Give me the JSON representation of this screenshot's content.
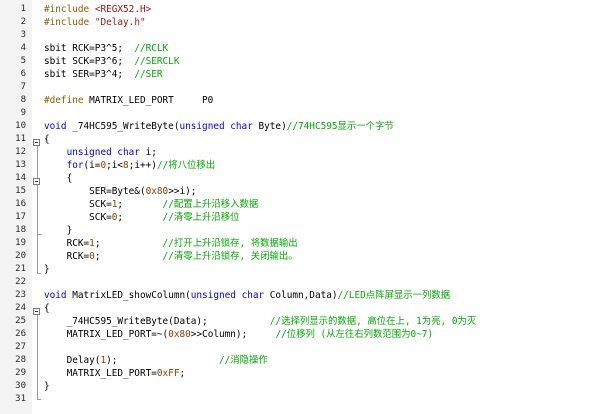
{
  "editor": {
    "lines": [
      {
        "n": "1",
        "tokens": [
          {
            "c": "pp",
            "t": "#include "
          },
          {
            "c": "str",
            "t": "<REGX52.H>"
          }
        ]
      },
      {
        "n": "2",
        "tokens": [
          {
            "c": "pp",
            "t": "#include "
          },
          {
            "c": "str",
            "t": "\"Delay.h\""
          }
        ]
      },
      {
        "n": "3",
        "tokens": []
      },
      {
        "n": "4",
        "tokens": [
          {
            "c": "pl",
            "t": "sbit RCK=P3^5;  "
          },
          {
            "c": "cm",
            "t": "//RCLK"
          }
        ]
      },
      {
        "n": "5",
        "tokens": [
          {
            "c": "pl",
            "t": "sbit SCK=P3^6;  "
          },
          {
            "c": "cm",
            "t": "//SERCLK"
          }
        ]
      },
      {
        "n": "6",
        "tokens": [
          {
            "c": "pl",
            "t": "sbit SER=P3^4;  "
          },
          {
            "c": "cm",
            "t": "//SER"
          }
        ]
      },
      {
        "n": "7",
        "tokens": []
      },
      {
        "n": "8",
        "tokens": [
          {
            "c": "pp",
            "t": "#define "
          },
          {
            "c": "pl",
            "t": "MATRIX_LED_PORT     P0"
          }
        ]
      },
      {
        "n": "9",
        "tokens": []
      },
      {
        "n": "10",
        "tokens": [
          {
            "c": "kw",
            "t": "void"
          },
          {
            "c": "pl",
            "t": " _74HC595_WriteByte("
          },
          {
            "c": "kw",
            "t": "unsigned char"
          },
          {
            "c": "pl",
            "t": " Byte)"
          },
          {
            "c": "cm",
            "t": "//74HC595显示一个字节"
          }
        ]
      },
      {
        "n": "11",
        "tokens": [
          {
            "c": "pl",
            "t": "{"
          }
        ]
      },
      {
        "n": "12",
        "tokens": [
          {
            "c": "pl",
            "t": "    "
          },
          {
            "c": "kw",
            "t": "unsigned char"
          },
          {
            "c": "pl",
            "t": " i;"
          }
        ]
      },
      {
        "n": "13",
        "tokens": [
          {
            "c": "pl",
            "t": "    "
          },
          {
            "c": "kw",
            "t": "for"
          },
          {
            "c": "pl",
            "t": "(i="
          },
          {
            "c": "num",
            "t": "0"
          },
          {
            "c": "pl",
            "t": ";i<"
          },
          {
            "c": "num",
            "t": "8"
          },
          {
            "c": "pl",
            "t": ";i++)"
          },
          {
            "c": "cm",
            "t": "//将八位移出"
          }
        ]
      },
      {
        "n": "14",
        "tokens": [
          {
            "c": "pl",
            "t": "    {"
          }
        ]
      },
      {
        "n": "15",
        "tokens": [
          {
            "c": "pl",
            "t": "        SER=Byte&("
          },
          {
            "c": "num",
            "t": "0x80"
          },
          {
            "c": "pl",
            "t": ">>i);"
          }
        ]
      },
      {
        "n": "16",
        "tokens": [
          {
            "c": "pl",
            "t": "        SCK="
          },
          {
            "c": "num",
            "t": "1"
          },
          {
            "c": "pl",
            "t": ";       "
          },
          {
            "c": "cm",
            "t": "//配置上升沿移入数据"
          }
        ]
      },
      {
        "n": "17",
        "tokens": [
          {
            "c": "pl",
            "t": "        SCK="
          },
          {
            "c": "num",
            "t": "0"
          },
          {
            "c": "pl",
            "t": ";       "
          },
          {
            "c": "cm",
            "t": "//清零上升沿移位"
          }
        ]
      },
      {
        "n": "18",
        "tokens": [
          {
            "c": "pl",
            "t": "    }"
          }
        ]
      },
      {
        "n": "19",
        "tokens": [
          {
            "c": "pl",
            "t": "    RCK="
          },
          {
            "c": "num",
            "t": "1"
          },
          {
            "c": "pl",
            "t": ";           "
          },
          {
            "c": "cm",
            "t": "//打开上升沿锁存, 将数据输出"
          }
        ]
      },
      {
        "n": "20",
        "tokens": [
          {
            "c": "pl",
            "t": "    RCK="
          },
          {
            "c": "num",
            "t": "0"
          },
          {
            "c": "pl",
            "t": ";           "
          },
          {
            "c": "cm",
            "t": "//清零上升沿锁存, 关闭输出。"
          }
        ]
      },
      {
        "n": "21",
        "tokens": [
          {
            "c": "pl",
            "t": "}"
          }
        ]
      },
      {
        "n": "22",
        "tokens": []
      },
      {
        "n": "23",
        "tokens": [
          {
            "c": "kw",
            "t": "void"
          },
          {
            "c": "pl",
            "t": " MatrixLED_showColumn("
          },
          {
            "c": "kw",
            "t": "unsigned char"
          },
          {
            "c": "pl",
            "t": " Column,Data)"
          },
          {
            "c": "cm",
            "t": "//LED点阵屏显示一列数据"
          }
        ]
      },
      {
        "n": "24",
        "tokens": [
          {
            "c": "pl",
            "t": "{"
          }
        ]
      },
      {
        "n": "25",
        "tokens": [
          {
            "c": "pl",
            "t": "    _74HC595_WriteByte(Data);           "
          },
          {
            "c": "cm",
            "t": "//选择列显示的数据, 高位在上, 1为亮, 0为灭"
          }
        ]
      },
      {
        "n": "26",
        "tokens": [
          {
            "c": "pl",
            "t": "    MATRIX_LED_PORT=~("
          },
          {
            "c": "num",
            "t": "0x80"
          },
          {
            "c": "pl",
            "t": ">>Column);     "
          },
          {
            "c": "cm",
            "t": "//位移列 (从左往右列数范围为0~7)"
          }
        ]
      },
      {
        "n": "27",
        "tokens": []
      },
      {
        "n": "28",
        "tokens": [
          {
            "c": "pl",
            "t": "    Delay("
          },
          {
            "c": "num",
            "t": "1"
          },
          {
            "c": "pl",
            "t": ");                  "
          },
          {
            "c": "cm",
            "t": "//消隐操作"
          }
        ]
      },
      {
        "n": "29",
        "tokens": [
          {
            "c": "pl",
            "t": "    MATRIX_LED_PORT="
          },
          {
            "c": "num",
            "t": "0xFF"
          },
          {
            "c": "pl",
            "t": ";"
          }
        ]
      },
      {
        "n": "30",
        "tokens": [
          {
            "c": "pl",
            "t": "}"
          }
        ]
      },
      {
        "n": "31",
        "tokens": []
      }
    ]
  },
  "colors": {
    "keyword": "#0000ff",
    "comment": "#00aa00",
    "preprocessor": "#8a5f00",
    "string": "#a31515",
    "number": "#8a3f00"
  }
}
